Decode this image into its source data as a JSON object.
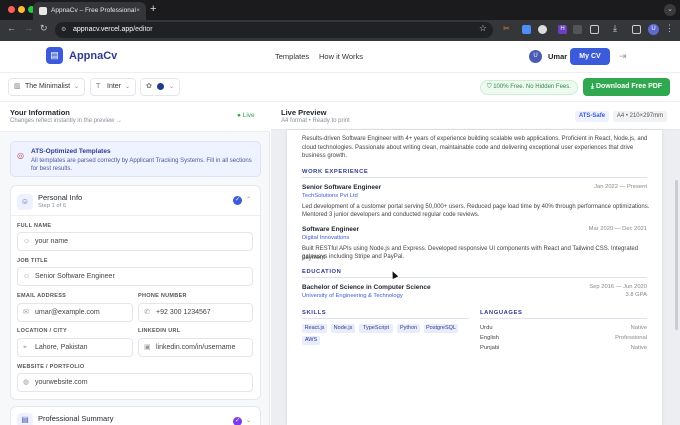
{
  "browser": {
    "tab_title": "AppnaCv – Free Professional",
    "tab_close": "×",
    "new_tab": "+",
    "url_domain": "appnacv.vercel.app",
    "url_path": "/editor",
    "ext_badge": "H",
    "profile_initial": "U"
  },
  "header": {
    "logo_glyph": "▤",
    "brand": "AppnaCv",
    "nav": [
      "Templates",
      "How it Works"
    ],
    "avatar_initial": "U",
    "user_name": "Umar",
    "my_cv": "My CV"
  },
  "options": {
    "template": "The Minimalist",
    "font": "Inter",
    "free_badge": "100% Free. No Hidden Fees.",
    "download": "Download Free PDF",
    "accent_color": "#1e3a8a"
  },
  "left": {
    "title": "Your Information",
    "subtitle": "Changes reflect instantly in the preview →",
    "live": "● Live",
    "ats_title": "ATS-Optimized Templates",
    "ats_desc": "All templates are parsed correctly by Applicant Tracking Systems. Fill in all sections for best results.",
    "personal": {
      "title": "Personal Info",
      "step": "Step 1 of 6",
      "full_name_label": "FULL NAME",
      "full_name": "your name",
      "job_title_label": "JOB TITLE",
      "job_title": "Senior Software Engineer",
      "email_label": "EMAIL ADDRESS",
      "email": "umar@example.com",
      "phone_label": "PHONE NUMBER",
      "phone": "+92 300 1234567",
      "location_label": "LOCATION / CITY",
      "location": "Lahore, Pakistan",
      "linkedin_label": "LINKEDIN URL",
      "linkedin": "linkedin.com/in/username",
      "website_label": "WEBSITE / PORTFOLIO",
      "website": "yourwebsite.com"
    },
    "summary_title": "Professional Summary"
  },
  "preview": {
    "title": "Live Preview",
    "subtitle": "A4 format • Ready to print",
    "ats_safe": "ATS-Safe",
    "a4": "A4 • 210×297mm",
    "summary": [
      "Results-driven Software Engineer with 4+ years of experience building scalable web applications. Proficient in React, Node.js, and",
      "cloud technologies. Passionate about writing clean, maintainable code and delivering exceptional user experiences that drive",
      "business growth."
    ],
    "work_heading": "WORK EXPERIENCE",
    "jobs": [
      {
        "title": "Senior Software Engineer",
        "company": "TechSolutions Pvt Ltd",
        "dates": "Jan 2022 — Present",
        "desc": [
          "Led development of a customer portal serving 50,000+ users. Reduced page load time by 40% through performance optimizations.",
          "Mentored 3 junior developers and conducted regular code reviews."
        ]
      },
      {
        "title": "Software Engineer",
        "company": "Digital Innovations",
        "dates": "Mar 2020 — Dec 2021",
        "desc": [
          "Built RESTful APIs using Node.js and Express. Developed responsive UI components with React and Tailwind CSS. Integrated payment",
          "gateways including Stripe and PayPal."
        ]
      }
    ],
    "education_heading": "EDUCATION",
    "edu": {
      "degree": "Bachelor of Science in Computer Science",
      "school": "University of Engineering & Technology",
      "dates": "Sep 2016 — Jun 2020",
      "gpa": "3.8 GPA"
    },
    "skills_heading": "SKILLS",
    "skills": [
      "React.js",
      "Node.js",
      "TypeScript",
      "Python",
      "PostgreSQL",
      "AWS"
    ],
    "languages_heading": "LANGUAGES",
    "languages": [
      {
        "name": "Urdu",
        "level": "Native"
      },
      {
        "name": "English",
        "level": "Professional"
      },
      {
        "name": "Punjabi",
        "level": "Native"
      }
    ]
  }
}
